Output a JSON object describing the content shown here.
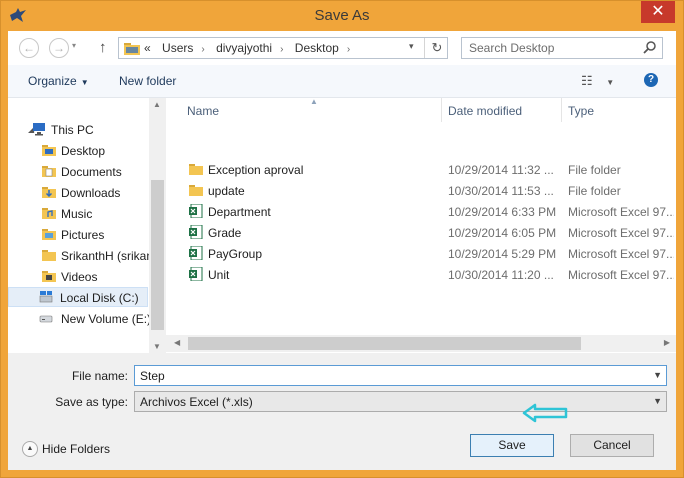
{
  "window": {
    "title": "Save As",
    "close_glyph": "✕"
  },
  "nav_buttons": {
    "back": "←",
    "forward": "→",
    "up": "↑"
  },
  "address": {
    "overflow": "«",
    "crumbs": [
      "Users",
      "divyajyothi",
      "Desktop"
    ],
    "refresh_glyph": "↻"
  },
  "search": {
    "placeholder": "Search Desktop"
  },
  "toolbar": {
    "organize": "Organize",
    "new_folder": "New folder",
    "help": "?"
  },
  "navpane": {
    "items": [
      {
        "label": "This PC",
        "icon": "computer-icon"
      },
      {
        "label": "Desktop",
        "icon": "folder-icon"
      },
      {
        "label": "Documents",
        "icon": "folder-icon"
      },
      {
        "label": "Downloads",
        "icon": "folder-icon"
      },
      {
        "label": "Music",
        "icon": "folder-icon"
      },
      {
        "label": "Pictures",
        "icon": "folder-icon"
      },
      {
        "label": "SrikanthH (srikan",
        "icon": "folder-icon"
      },
      {
        "label": "Videos",
        "icon": "folder-icon"
      },
      {
        "label": "Local Disk (C:)",
        "icon": "drive-icon",
        "selected": true
      },
      {
        "label": "New Volume (E:)",
        "icon": "drive-icon"
      }
    ]
  },
  "columns": {
    "name": "Name",
    "date": "Date modified",
    "type": "Type"
  },
  "files": [
    {
      "name": "Exception aproval",
      "date": "10/29/2014 11:32 ...",
      "type": "File folder",
      "icon": "folder-icon"
    },
    {
      "name": "update",
      "date": "10/30/2014 11:53 ...",
      "type": "File folder",
      "icon": "folder-icon"
    },
    {
      "name": "Department",
      "date": "10/29/2014 6:33 PM",
      "type": "Microsoft Excel 97...",
      "icon": "excel-icon"
    },
    {
      "name": "Grade",
      "date": "10/29/2014 6:05 PM",
      "type": "Microsoft Excel 97...",
      "icon": "excel-icon"
    },
    {
      "name": "PayGroup",
      "date": "10/29/2014 5:29 PM",
      "type": "Microsoft Excel 97...",
      "icon": "excel-icon"
    },
    {
      "name": "Unit",
      "date": "10/30/2014 11:20 ...",
      "type": "Microsoft Excel 97...",
      "icon": "excel-icon"
    }
  ],
  "form": {
    "file_name_label": "File name:",
    "file_name_value": "Step",
    "save_type_label": "Save as type:",
    "save_type_value": "Archivos Excel (*.xls)"
  },
  "footer": {
    "hide_folders": "Hide Folders",
    "save": "Save",
    "cancel": "Cancel"
  },
  "colors": {
    "title_bar": "#f0a53a",
    "annotation_arrow": "#2ec4d6",
    "close": "#c7392b"
  }
}
